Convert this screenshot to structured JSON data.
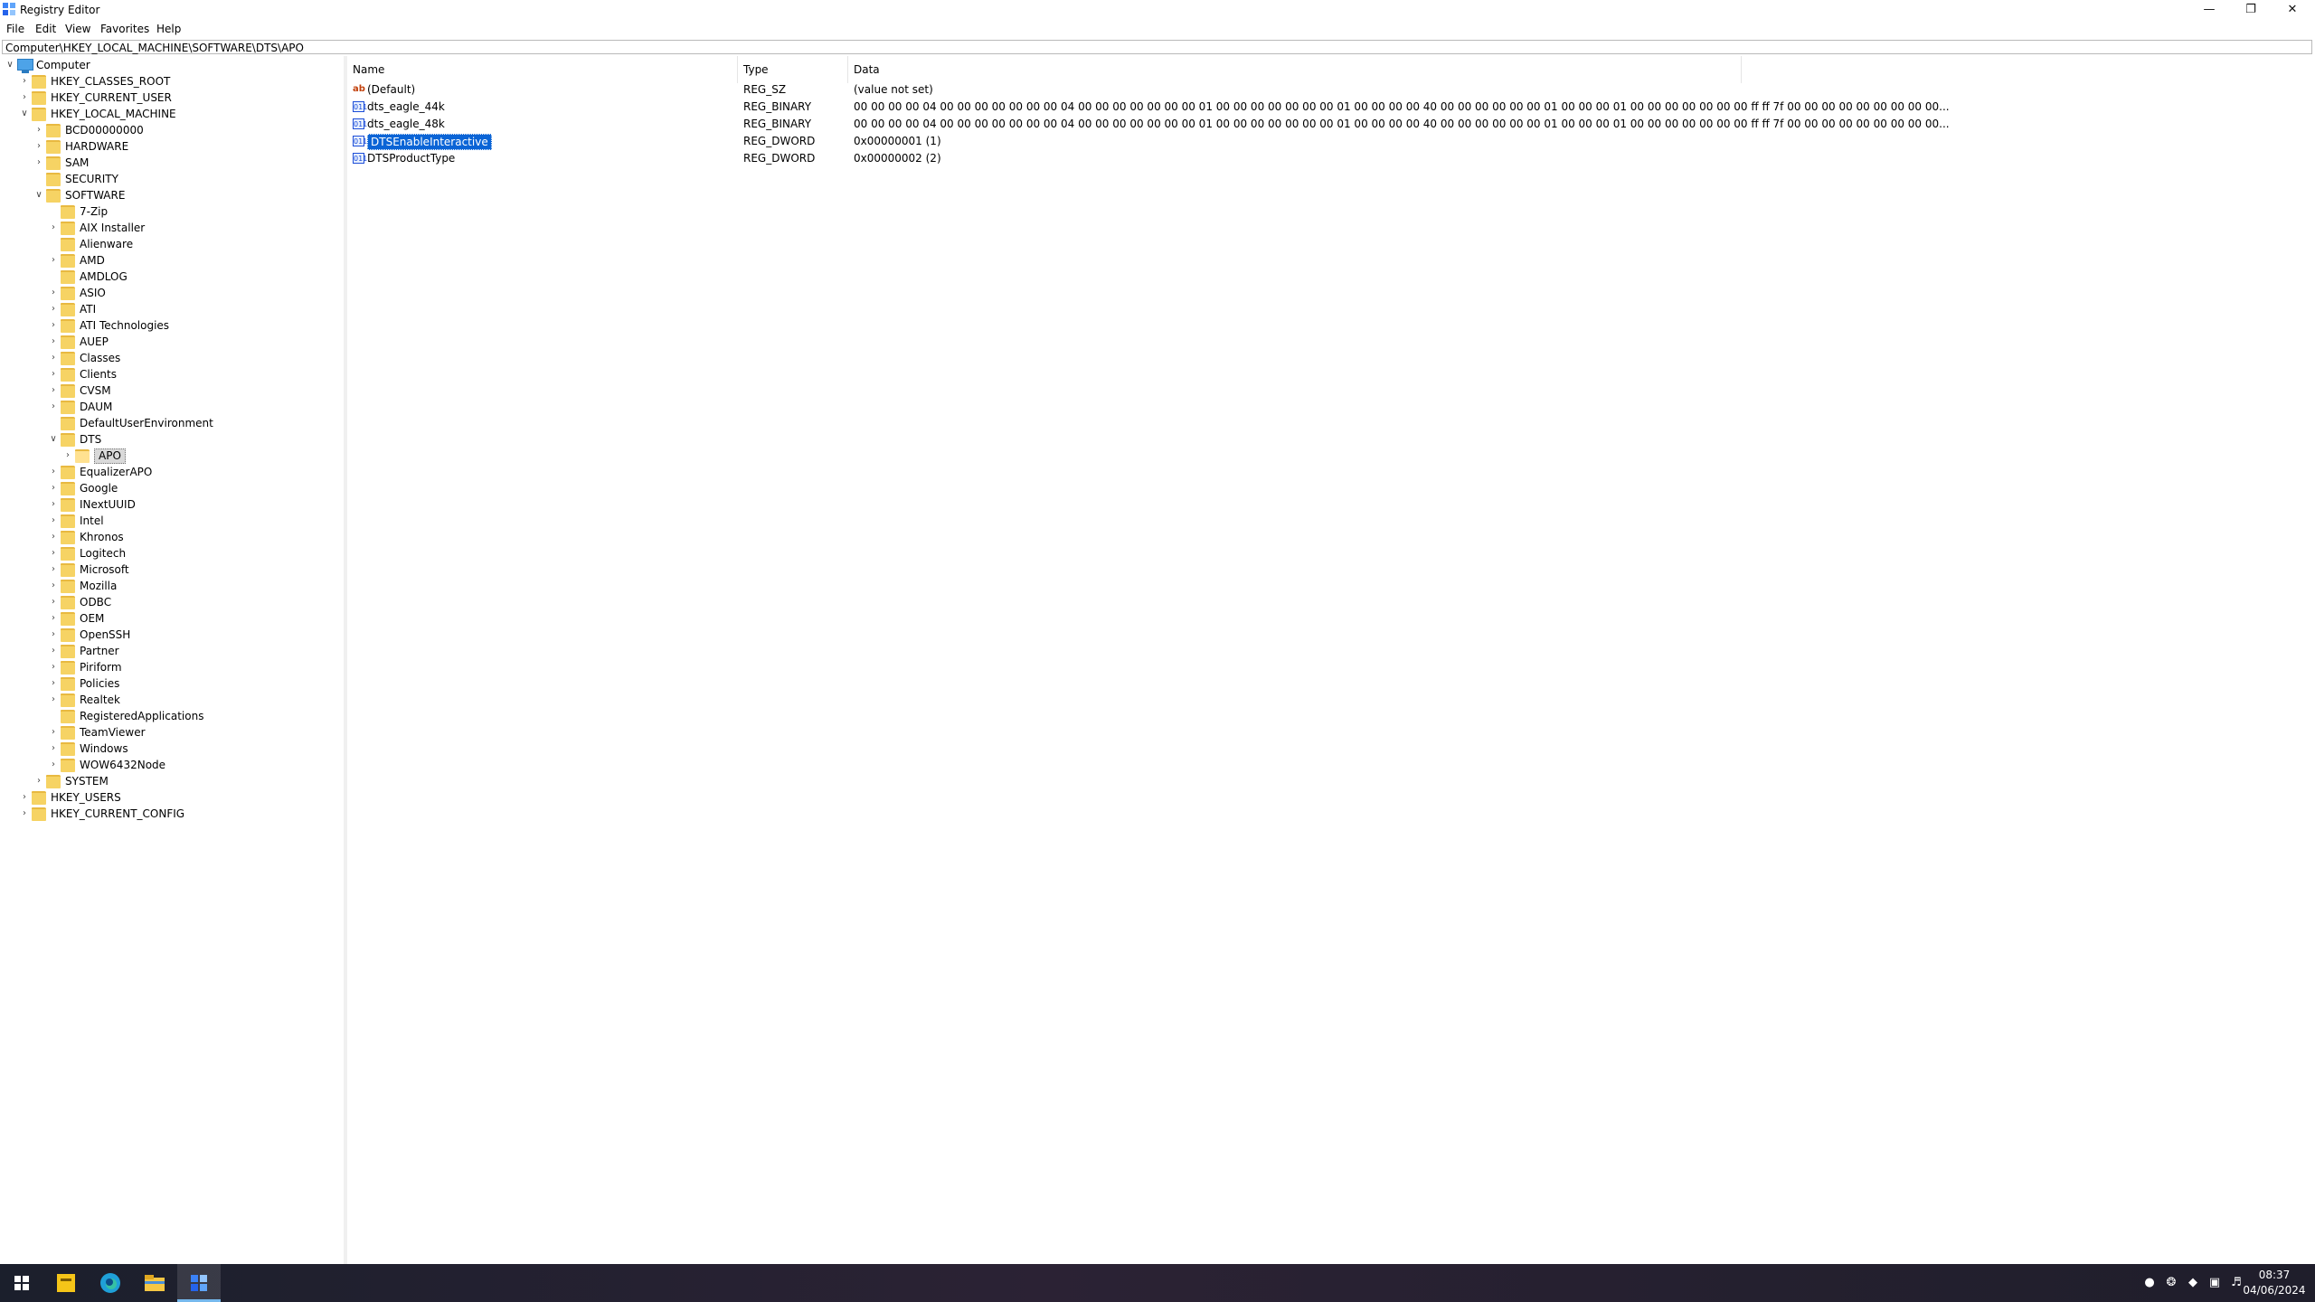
{
  "window": {
    "title": "Registry Editor"
  },
  "menu": [
    "File",
    "Edit",
    "View",
    "Favorites",
    "Help"
  ],
  "address": "Computer\\HKEY_LOCAL_MACHINE\\SOFTWARE\\DTS\\APO",
  "tree": [
    {
      "label": "Computer",
      "depth": 0,
      "icon": "computer-icon",
      "expander": "expanded"
    },
    {
      "label": "HKEY_CLASSES_ROOT",
      "depth": 1,
      "expander": "collapsed"
    },
    {
      "label": "HKEY_CURRENT_USER",
      "depth": 1,
      "expander": "collapsed"
    },
    {
      "label": "HKEY_LOCAL_MACHINE",
      "depth": 1,
      "expander": "expanded"
    },
    {
      "label": "BCD00000000",
      "depth": 2,
      "expander": "collapsed"
    },
    {
      "label": "HARDWARE",
      "depth": 2,
      "expander": "collapsed"
    },
    {
      "label": "SAM",
      "depth": 2,
      "expander": "collapsed"
    },
    {
      "label": "SECURITY",
      "depth": 2,
      "expander": "none"
    },
    {
      "label": "SOFTWARE",
      "depth": 2,
      "expander": "expanded"
    },
    {
      "label": "7-Zip",
      "depth": 3,
      "expander": "none"
    },
    {
      "label": "AIX Installer",
      "depth": 3,
      "expander": "collapsed"
    },
    {
      "label": "Alienware",
      "depth": 3,
      "expander": "none"
    },
    {
      "label": "AMD",
      "depth": 3,
      "expander": "collapsed"
    },
    {
      "label": "AMDLOG",
      "depth": 3,
      "expander": "none"
    },
    {
      "label": "ASIO",
      "depth": 3,
      "expander": "collapsed"
    },
    {
      "label": "ATI",
      "depth": 3,
      "expander": "collapsed"
    },
    {
      "label": "ATI Technologies",
      "depth": 3,
      "expander": "collapsed"
    },
    {
      "label": "AUEP",
      "depth": 3,
      "expander": "collapsed"
    },
    {
      "label": "Classes",
      "depth": 3,
      "expander": "collapsed"
    },
    {
      "label": "Clients",
      "depth": 3,
      "expander": "collapsed"
    },
    {
      "label": "CVSM",
      "depth": 3,
      "expander": "collapsed"
    },
    {
      "label": "DAUM",
      "depth": 3,
      "expander": "collapsed"
    },
    {
      "label": "DefaultUserEnvironment",
      "depth": 3,
      "expander": "none"
    },
    {
      "label": "DTS",
      "depth": 3,
      "expander": "expanded"
    },
    {
      "label": "APO",
      "depth": 4,
      "expander": "collapsed",
      "selected": true,
      "open": true
    },
    {
      "label": "EqualizerAPO",
      "depth": 3,
      "expander": "collapsed"
    },
    {
      "label": "Google",
      "depth": 3,
      "expander": "collapsed"
    },
    {
      "label": "INextUUID",
      "depth": 3,
      "expander": "collapsed"
    },
    {
      "label": "Intel",
      "depth": 3,
      "expander": "collapsed"
    },
    {
      "label": "Khronos",
      "depth": 3,
      "expander": "collapsed"
    },
    {
      "label": "Logitech",
      "depth": 3,
      "expander": "collapsed"
    },
    {
      "label": "Microsoft",
      "depth": 3,
      "expander": "collapsed"
    },
    {
      "label": "Mozilla",
      "depth": 3,
      "expander": "collapsed"
    },
    {
      "label": "ODBC",
      "depth": 3,
      "expander": "collapsed"
    },
    {
      "label": "OEM",
      "depth": 3,
      "expander": "collapsed"
    },
    {
      "label": "OpenSSH",
      "depth": 3,
      "expander": "collapsed"
    },
    {
      "label": "Partner",
      "depth": 3,
      "expander": "collapsed"
    },
    {
      "label": "Piriform",
      "depth": 3,
      "expander": "collapsed"
    },
    {
      "label": "Policies",
      "depth": 3,
      "expander": "collapsed"
    },
    {
      "label": "Realtek",
      "depth": 3,
      "expander": "collapsed"
    },
    {
      "label": "RegisteredApplications",
      "depth": 3,
      "expander": "none"
    },
    {
      "label": "TeamViewer",
      "depth": 3,
      "expander": "collapsed"
    },
    {
      "label": "Windows",
      "depth": 3,
      "expander": "collapsed"
    },
    {
      "label": "WOW6432Node",
      "depth": 3,
      "expander": "collapsed"
    },
    {
      "label": "SYSTEM",
      "depth": 2,
      "expander": "collapsed"
    },
    {
      "label": "HKEY_USERS",
      "depth": 1,
      "expander": "collapsed"
    },
    {
      "label": "HKEY_CURRENT_CONFIG",
      "depth": 1,
      "expander": "collapsed"
    }
  ],
  "columns": {
    "name": "Name",
    "type": "Type",
    "data": "Data"
  },
  "values": [
    {
      "name": "(Default)",
      "type": "REG_SZ",
      "data": "(value not set)",
      "icon": "string-value-icon"
    },
    {
      "name": "dts_eagle_44k",
      "type": "REG_BINARY",
      "data": "00 00 00 00 04 00 00 00 00 00 00 00 04 00 00 00 00 00 00 00 01 00 00 00 00 00 00 00 01 00 00 00 00 40 00 00 00 00 00 00 01 00 00 00 01 00 00 00 00 00 00 00 ff ff 7f 00 00 00 00 00 00 00 00 00...",
      "icon": "binary-value-icon"
    },
    {
      "name": "dts_eagle_48k",
      "type": "REG_BINARY",
      "data": "00 00 00 00 04 00 00 00 00 00 00 00 04 00 00 00 00 00 00 00 01 00 00 00 00 00 00 00 01 00 00 00 00 40 00 00 00 00 00 00 01 00 00 00 01 00 00 00 00 00 00 00 ff ff 7f 00 00 00 00 00 00 00 00 00...",
      "icon": "binary-value-icon"
    },
    {
      "name": "DTSEnableInteractive",
      "type": "REG_DWORD",
      "data": "0x00000001 (1)",
      "icon": "binary-value-icon",
      "selected": true
    },
    {
      "name": "DTSProductType",
      "type": "REG_DWORD",
      "data": "0x00000002 (2)",
      "icon": "binary-value-icon"
    }
  ],
  "taskbar": {
    "apps": [
      "start-button",
      "sticky-notes-app",
      "edge-browser",
      "file-explorer",
      "registry-editor"
    ],
    "clock_time": "08:37",
    "clock_date": "04/06/2024",
    "accent": "#76b9ed"
  }
}
